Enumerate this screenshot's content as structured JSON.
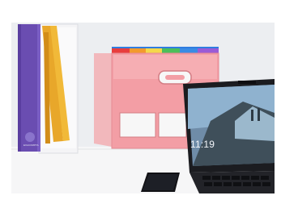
{
  "scene": {
    "description_items": [
      "binder",
      "magazine-holder",
      "expanding-file",
      "laptop",
      "smartphone"
    ],
    "laptop_screen": {
      "clock_text": "11:19"
    },
    "binder": {
      "brand_text": "EXACOMPTA"
    },
    "colors": {
      "background": "#ffffff",
      "binder": "#6b4fb3",
      "file_folder": "#f29aa0",
      "laptop_body": "#1b1c20",
      "desk": "#f7f7f7"
    }
  }
}
